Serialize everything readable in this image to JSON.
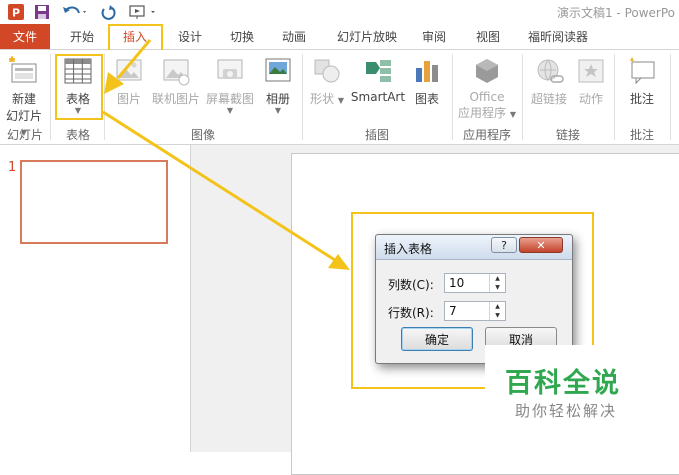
{
  "app": {
    "title": "演示文稿1 - PowerPo"
  },
  "tabs": [
    {
      "label": "文件"
    },
    {
      "label": "开始"
    },
    {
      "label": "插入"
    },
    {
      "label": "设计"
    },
    {
      "label": "切换"
    },
    {
      "label": "动画"
    },
    {
      "label": "幻灯片放映"
    },
    {
      "label": "审阅"
    },
    {
      "label": "视图"
    },
    {
      "label": "福昕阅读器"
    }
  ],
  "ribbon": {
    "buttons": [
      {
        "label": "新建",
        "label2": "幻灯片",
        "icon": "new-slide-icon"
      },
      {
        "label": "表格",
        "icon": "table-icon"
      },
      {
        "label": "图片",
        "icon": "picture-icon"
      },
      {
        "label": "联机图片",
        "icon": "online-picture-icon"
      },
      {
        "label": "屏幕截图",
        "icon": "screenshot-icon"
      },
      {
        "label": "相册",
        "icon": "photo-album-icon"
      },
      {
        "label": "形状",
        "icon": "shapes-icon"
      },
      {
        "label": "SmartArt",
        "icon": "smartart-icon"
      },
      {
        "label": "图表",
        "icon": "chart-icon"
      },
      {
        "label": "Office",
        "label2": "应用程序",
        "icon": "office-apps-icon"
      },
      {
        "label": "超链接",
        "icon": "hyperlink-icon"
      },
      {
        "label": "动作",
        "icon": "action-icon"
      },
      {
        "label": "批注",
        "icon": "comment-icon"
      }
    ],
    "groups": [
      {
        "label": "幻灯片"
      },
      {
        "label": "表格"
      },
      {
        "label": "图像"
      },
      {
        "label": "插图"
      },
      {
        "label": "应用程序"
      },
      {
        "label": "链接"
      },
      {
        "label": "批注"
      }
    ]
  },
  "thumbnails": {
    "slide_number": "1"
  },
  "dialog": {
    "title": "插入表格",
    "help_label": "?",
    "close_label": "✕",
    "columns_label": "列数(C):",
    "columns_value": "10",
    "rows_label": "行数(R):",
    "rows_value": "7",
    "ok_label": "确定",
    "cancel_label": "取消"
  },
  "watermark": {
    "title": "百科全说",
    "subtitle": "助你轻松解决"
  },
  "colors": {
    "accent": "#d24726",
    "highlight": "#f3c31a",
    "watermark": "#2fa84f"
  }
}
